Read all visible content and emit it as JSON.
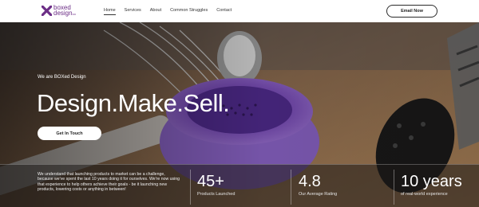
{
  "header": {
    "logo_line1": "boxed",
    "logo_line2": "design",
    "logo_suffix": "co",
    "nav": [
      "Home",
      "Services",
      "About",
      "Common Struggles",
      "Contact"
    ],
    "email_button": "Email Now"
  },
  "hero": {
    "tagline": "We are BOXed Design",
    "headline": "Design.Make.Sell.",
    "cta": "Get In Touch",
    "blurb": "We understand that launching products to market can be a challenge, because we've spent the last 10 years doing it for ourselves. We're now using that experience to help others achieve their goals - be it launching new products, lowering costs or anything in between!",
    "stats": [
      {
        "value": "45+",
        "label": "Products Launched"
      },
      {
        "value": "4.8",
        "label": "Our Average Rating"
      },
      {
        "value": "10 years",
        "label": "of real-world experience"
      }
    ]
  },
  "colors": {
    "brand_purple": "#6c2e86",
    "bowl_purple": "#7b4fb8"
  }
}
